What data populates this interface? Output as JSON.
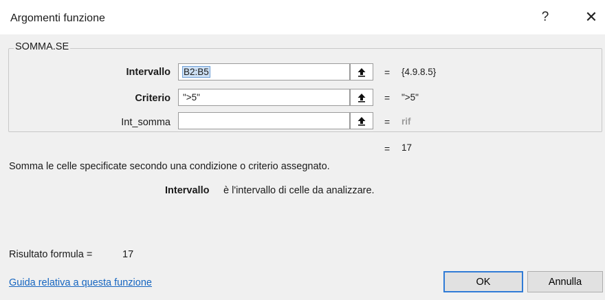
{
  "dialog": {
    "title": "Argomenti funzione",
    "help_glyph": "?",
    "close_glyph": "✕"
  },
  "function_group": {
    "name": "SOMMA.SE"
  },
  "arguments": [
    {
      "label": "Intervallo",
      "value": "B2:B5",
      "result": "{4.9.8.5}",
      "required": true,
      "ref_icon": "range-select-icon"
    },
    {
      "label": "Criterio",
      "value": "\">5\"",
      "result": "\">5\"",
      "required": true,
      "ref_icon": "range-select-icon"
    },
    {
      "label": "Int_somma",
      "value": "",
      "result": "rif",
      "required": false,
      "ref_icon": "range-select-icon"
    }
  ],
  "equals_sign": "=",
  "overall_result": "17",
  "description": "Somma le celle specificate secondo una condizione o criterio assegnato.",
  "current_arg": {
    "name": "Intervallo",
    "description": "è l'intervallo di celle da analizzare."
  },
  "formula_result": {
    "label": "Risultato formula =",
    "value": "17"
  },
  "footer": {
    "help_link": "Guida relativa a questa funzione",
    "ok_label": "OK",
    "cancel_label": "Annulla"
  },
  "colors": {
    "dialog_bg": "#f0f0f0",
    "titlebar_bg": "#ffffff",
    "link": "#1565c0",
    "ok_border": "#2f7bd6",
    "dim_value": "#9a9a9a"
  }
}
